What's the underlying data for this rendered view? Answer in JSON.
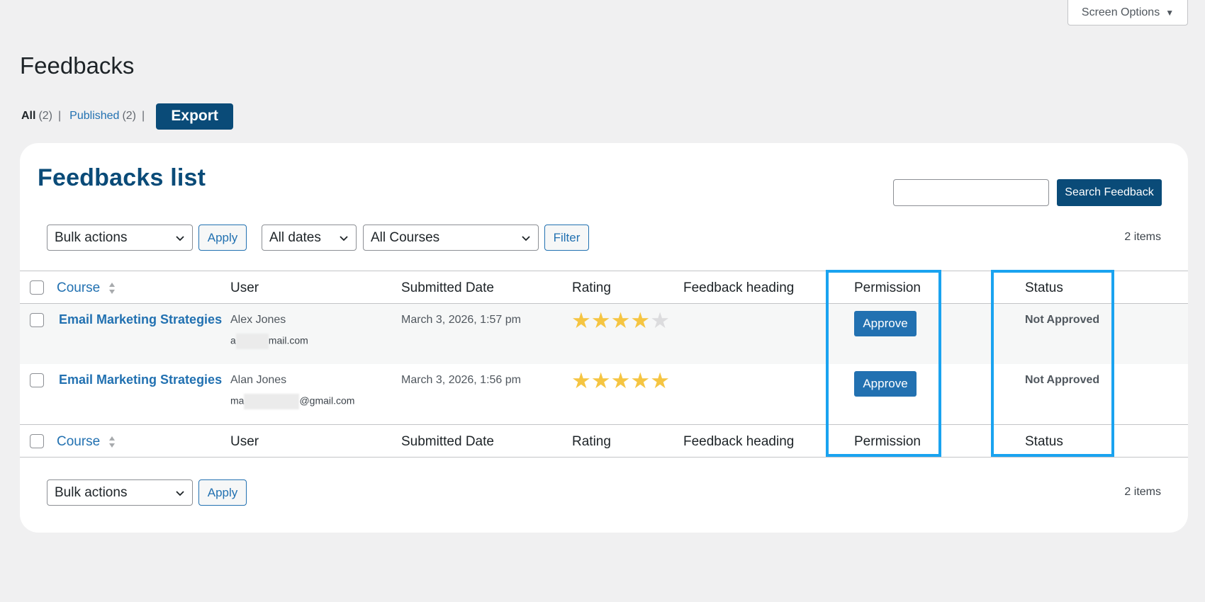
{
  "screen_options": {
    "label": "Screen Options",
    "icon": "caret-down-icon"
  },
  "page_title": "Feedbacks",
  "views": {
    "all": {
      "label": "All",
      "count": "(2)"
    },
    "separator": "|",
    "published": {
      "label": "Published",
      "count": "(2)"
    }
  },
  "export_label": "Export",
  "card": {
    "title": "Feedbacks list"
  },
  "search": {
    "value": "",
    "button": "Search Feedback"
  },
  "top_nav": {
    "bulk_actions": "Bulk actions",
    "apply": "Apply",
    "dates": "All dates",
    "courses": "All Courses",
    "filter": "Filter",
    "items": "2 items"
  },
  "bottom_nav": {
    "bulk_actions": "Bulk actions",
    "apply": "Apply",
    "items": "2 items"
  },
  "columns": {
    "course": "Course",
    "user": "User",
    "submitted": "Submitted Date",
    "rating": "Rating",
    "heading": "Feedback heading",
    "permission": "Permission",
    "status": "Status"
  },
  "rows": [
    {
      "course": "Email Marketing Strategies",
      "user_name": "Alex Jones",
      "email_prefix": "a",
      "email_suffix": "mail.com",
      "date": "March 3, 2026, 1:57 pm",
      "rating": 4,
      "rating_max": 5,
      "permission": "Approve",
      "status": "Not Approved"
    },
    {
      "course": "Email Marketing Strategies",
      "user_name": "Alan Jones",
      "email_prefix": "ma",
      "email_suffix": "@gmail.com",
      "date": "March 3, 2026, 1:56 pm",
      "rating": 5,
      "rating_max": 5,
      "permission": "Approve",
      "status": "Not Approved"
    }
  ],
  "colors": {
    "background": "#f0f0f1",
    "primary_dark": "#0a4b78",
    "link": "#2271b1",
    "star": "#f5c542",
    "highlight": "#1aa3f0"
  }
}
